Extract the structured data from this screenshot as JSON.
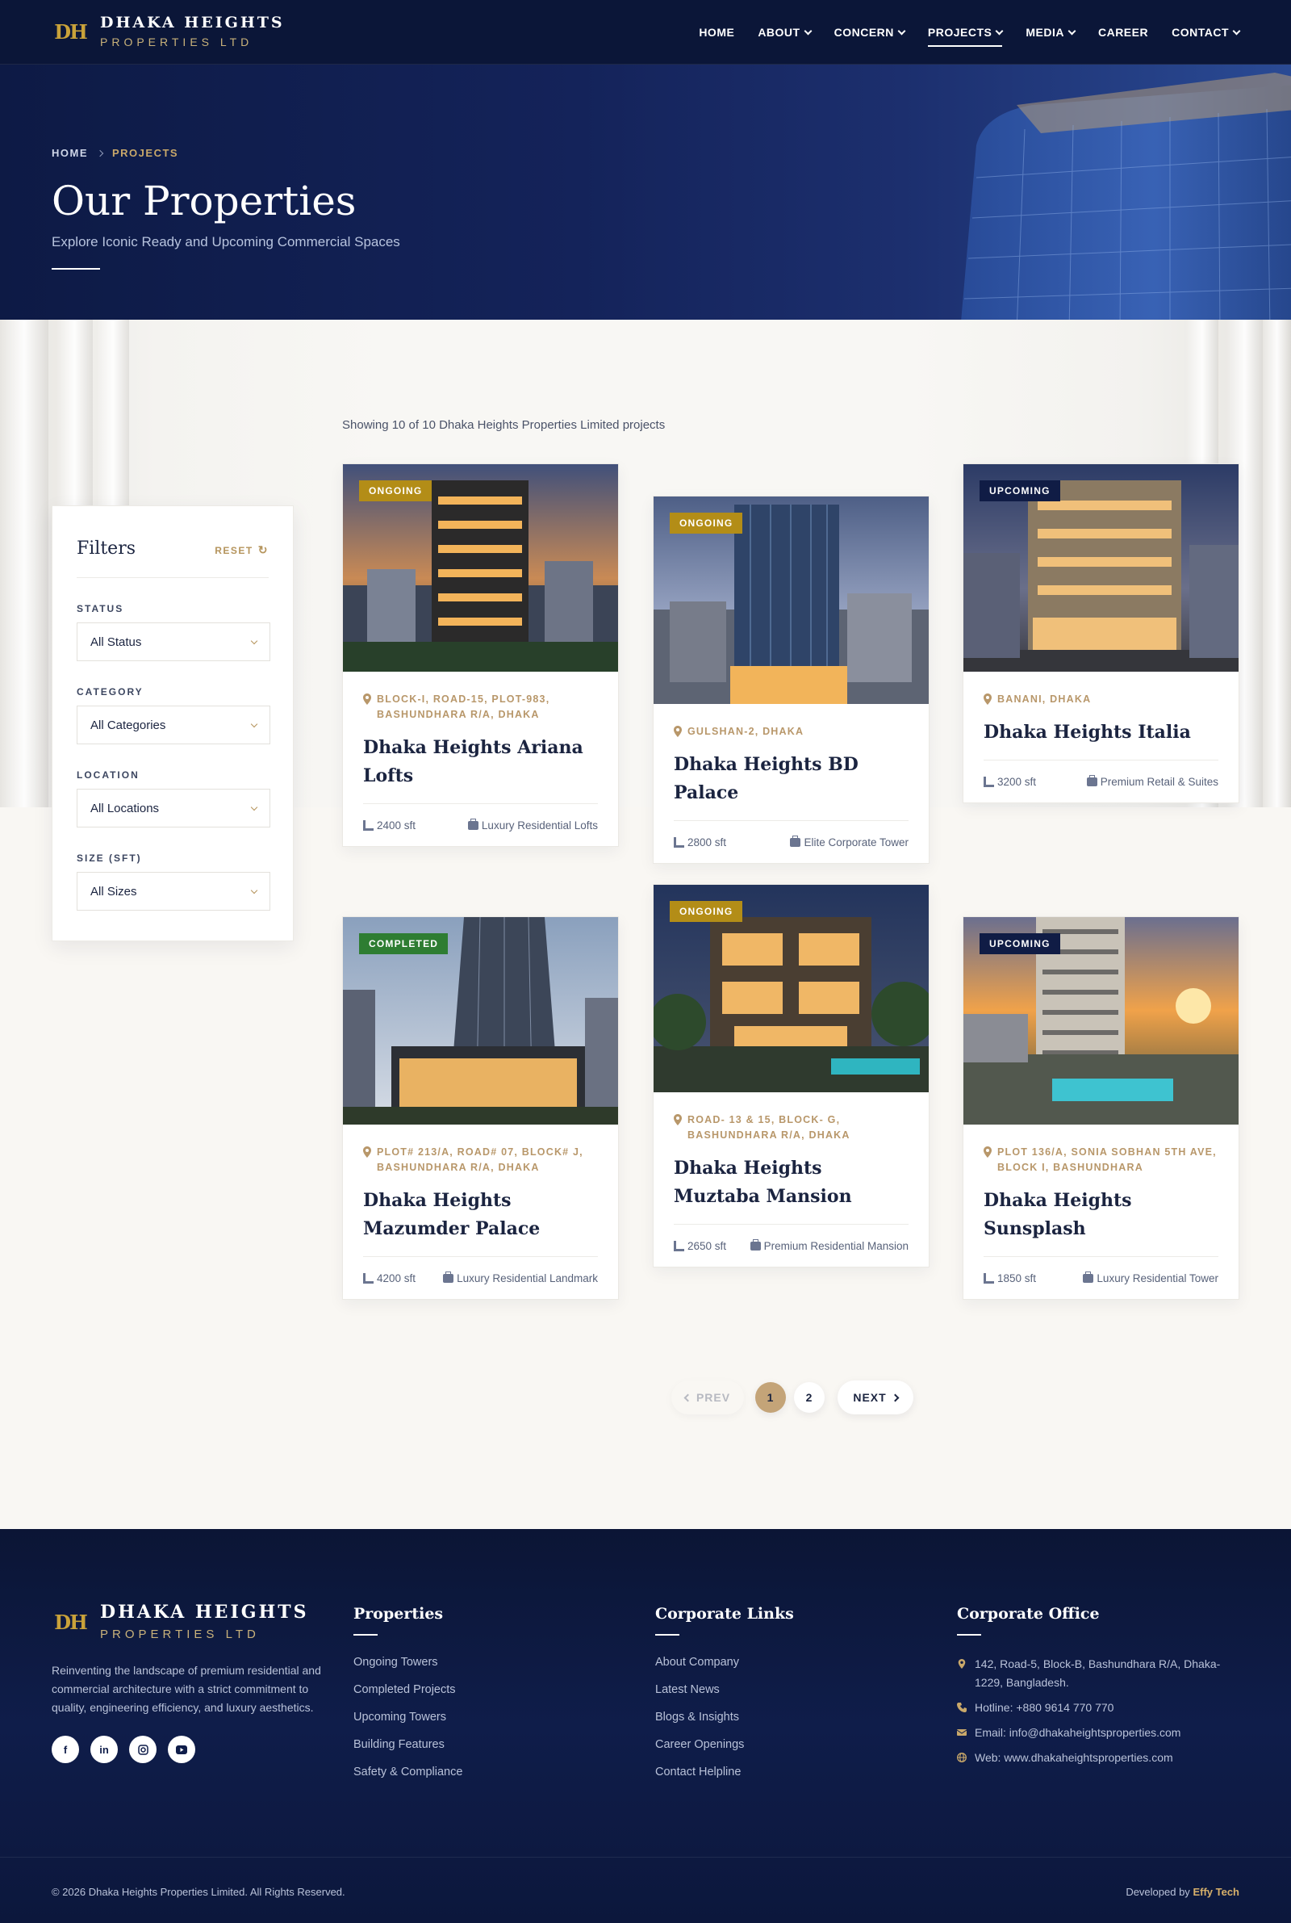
{
  "header": {
    "logo_mark": "DH",
    "brand_name": "DHAKA HEIGHTS",
    "brand_sub": "PROPERTIES LTD",
    "nav": [
      {
        "label": "HOME",
        "dropdown": false,
        "active": false
      },
      {
        "label": "ABOUT",
        "dropdown": true,
        "active": false
      },
      {
        "label": "CONCERN",
        "dropdown": true,
        "active": false
      },
      {
        "label": "PROJECTS",
        "dropdown": true,
        "active": true
      },
      {
        "label": "MEDIA",
        "dropdown": true,
        "active": false
      },
      {
        "label": "CAREER",
        "dropdown": false,
        "active": false
      },
      {
        "label": "CONTACT",
        "dropdown": true,
        "active": false
      }
    ]
  },
  "hero": {
    "breadcrumb_home": "HOME",
    "breadcrumb_current": "PROJECTS",
    "title": "Our Properties",
    "subtitle": "Explore Iconic Ready and Upcoming Commercial Spaces"
  },
  "listing": {
    "showing_text": "Showing 10 of 10 Dhaka Heights Properties Limited projects"
  },
  "filters": {
    "title": "Filters",
    "reset_label": "RESET",
    "groups": [
      {
        "label": "STATUS",
        "value": "All Status"
      },
      {
        "label": "CATEGORY",
        "value": "All Categories"
      },
      {
        "label": "LOCATION",
        "value": "All Locations"
      },
      {
        "label": "SIZE (SFT)",
        "value": "All Sizes"
      }
    ]
  },
  "cards": [
    {
      "status": "ONGOING",
      "location": "BLOCK-I, ROAD-15, PLOT-983, BASHUNDHARA R/A, DHAKA",
      "title": "Dhaka Heights Ariana Lofts",
      "size": "2400 sft",
      "category": "Luxury Residential Lofts"
    },
    {
      "status": "ONGOING",
      "location": "GULSHAN-2, DHAKA",
      "title": "Dhaka Heights BD Palace",
      "size": "2800 sft",
      "category": "Elite Corporate Tower"
    },
    {
      "status": "UPCOMING",
      "location": "BANANI, DHAKA",
      "title": "Dhaka Heights Italia",
      "size": "3200 sft",
      "category": "Premium Retail & Suites"
    },
    {
      "status": "COMPLETED",
      "location": "PLOT# 213/A, ROAD# 07, BLOCK# J, BASHUNDHARA R/A, DHAKA",
      "title": "Dhaka Heights Mazumder Palace",
      "size": "4200 sft",
      "category": "Luxury Residential Landmark"
    },
    {
      "status": "ONGOING",
      "location": "ROAD- 13 & 15, BLOCK- G, BASHUNDHARA R/A, DHAKA",
      "title": "Dhaka Heights Muztaba Mansion",
      "size": "2650 sft",
      "category": "Premium Residential Mansion"
    },
    {
      "status": "UPCOMING",
      "location": "PLOT 136/A, SONIA SOBHAN 5TH AVE, BLOCK I, BASHUNDHARA",
      "title": "Dhaka Heights Sunsplash",
      "size": "1850 sft",
      "category": "Luxury Residential Tower"
    }
  ],
  "pagination": {
    "prev": "PREV",
    "pages": [
      "1",
      "2"
    ],
    "current": "1",
    "next": "NEXT"
  },
  "footer": {
    "brand_name": "DHAKA HEIGHTS",
    "brand_sub": "PROPERTIES LTD",
    "about": "Reinventing the landscape of premium residential and commercial architecture with a strict commitment to quality, engineering efficiency, and luxury aesthetics.",
    "socials": [
      "f",
      "in",
      "ig",
      "yt"
    ],
    "properties_title": "Properties",
    "properties_links": [
      "Ongoing Towers",
      "Completed Projects",
      "Upcoming Towers",
      "Building Features",
      "Safety & Compliance"
    ],
    "corporate_title": "Corporate Links",
    "corporate_links": [
      "About Company",
      "Latest News",
      "Blogs & Insights",
      "Career Openings",
      "Contact Helpline"
    ],
    "office_title": "Corporate Office",
    "address": "142, Road-5, Block-B, Bashundhara R/A, Dhaka-1229, Bangladesh.",
    "hotline": "Hotline: +880 9614 770 770",
    "email": "Email: info@dhakaheightsproperties.com",
    "web": "Web: www.dhakaheightsproperties.com",
    "copyright": "© 2026 Dhaka Heights Properties Limited. All Rights Reserved.",
    "developed_by": "Developed by",
    "developer": "Effy Tech"
  },
  "colors": {
    "navy": "#0b1638",
    "gold": "#c9a86a",
    "ongoing_badge": "#b38d17",
    "upcoming_badge": "#101c45",
    "completed_badge": "#2e7d32"
  }
}
